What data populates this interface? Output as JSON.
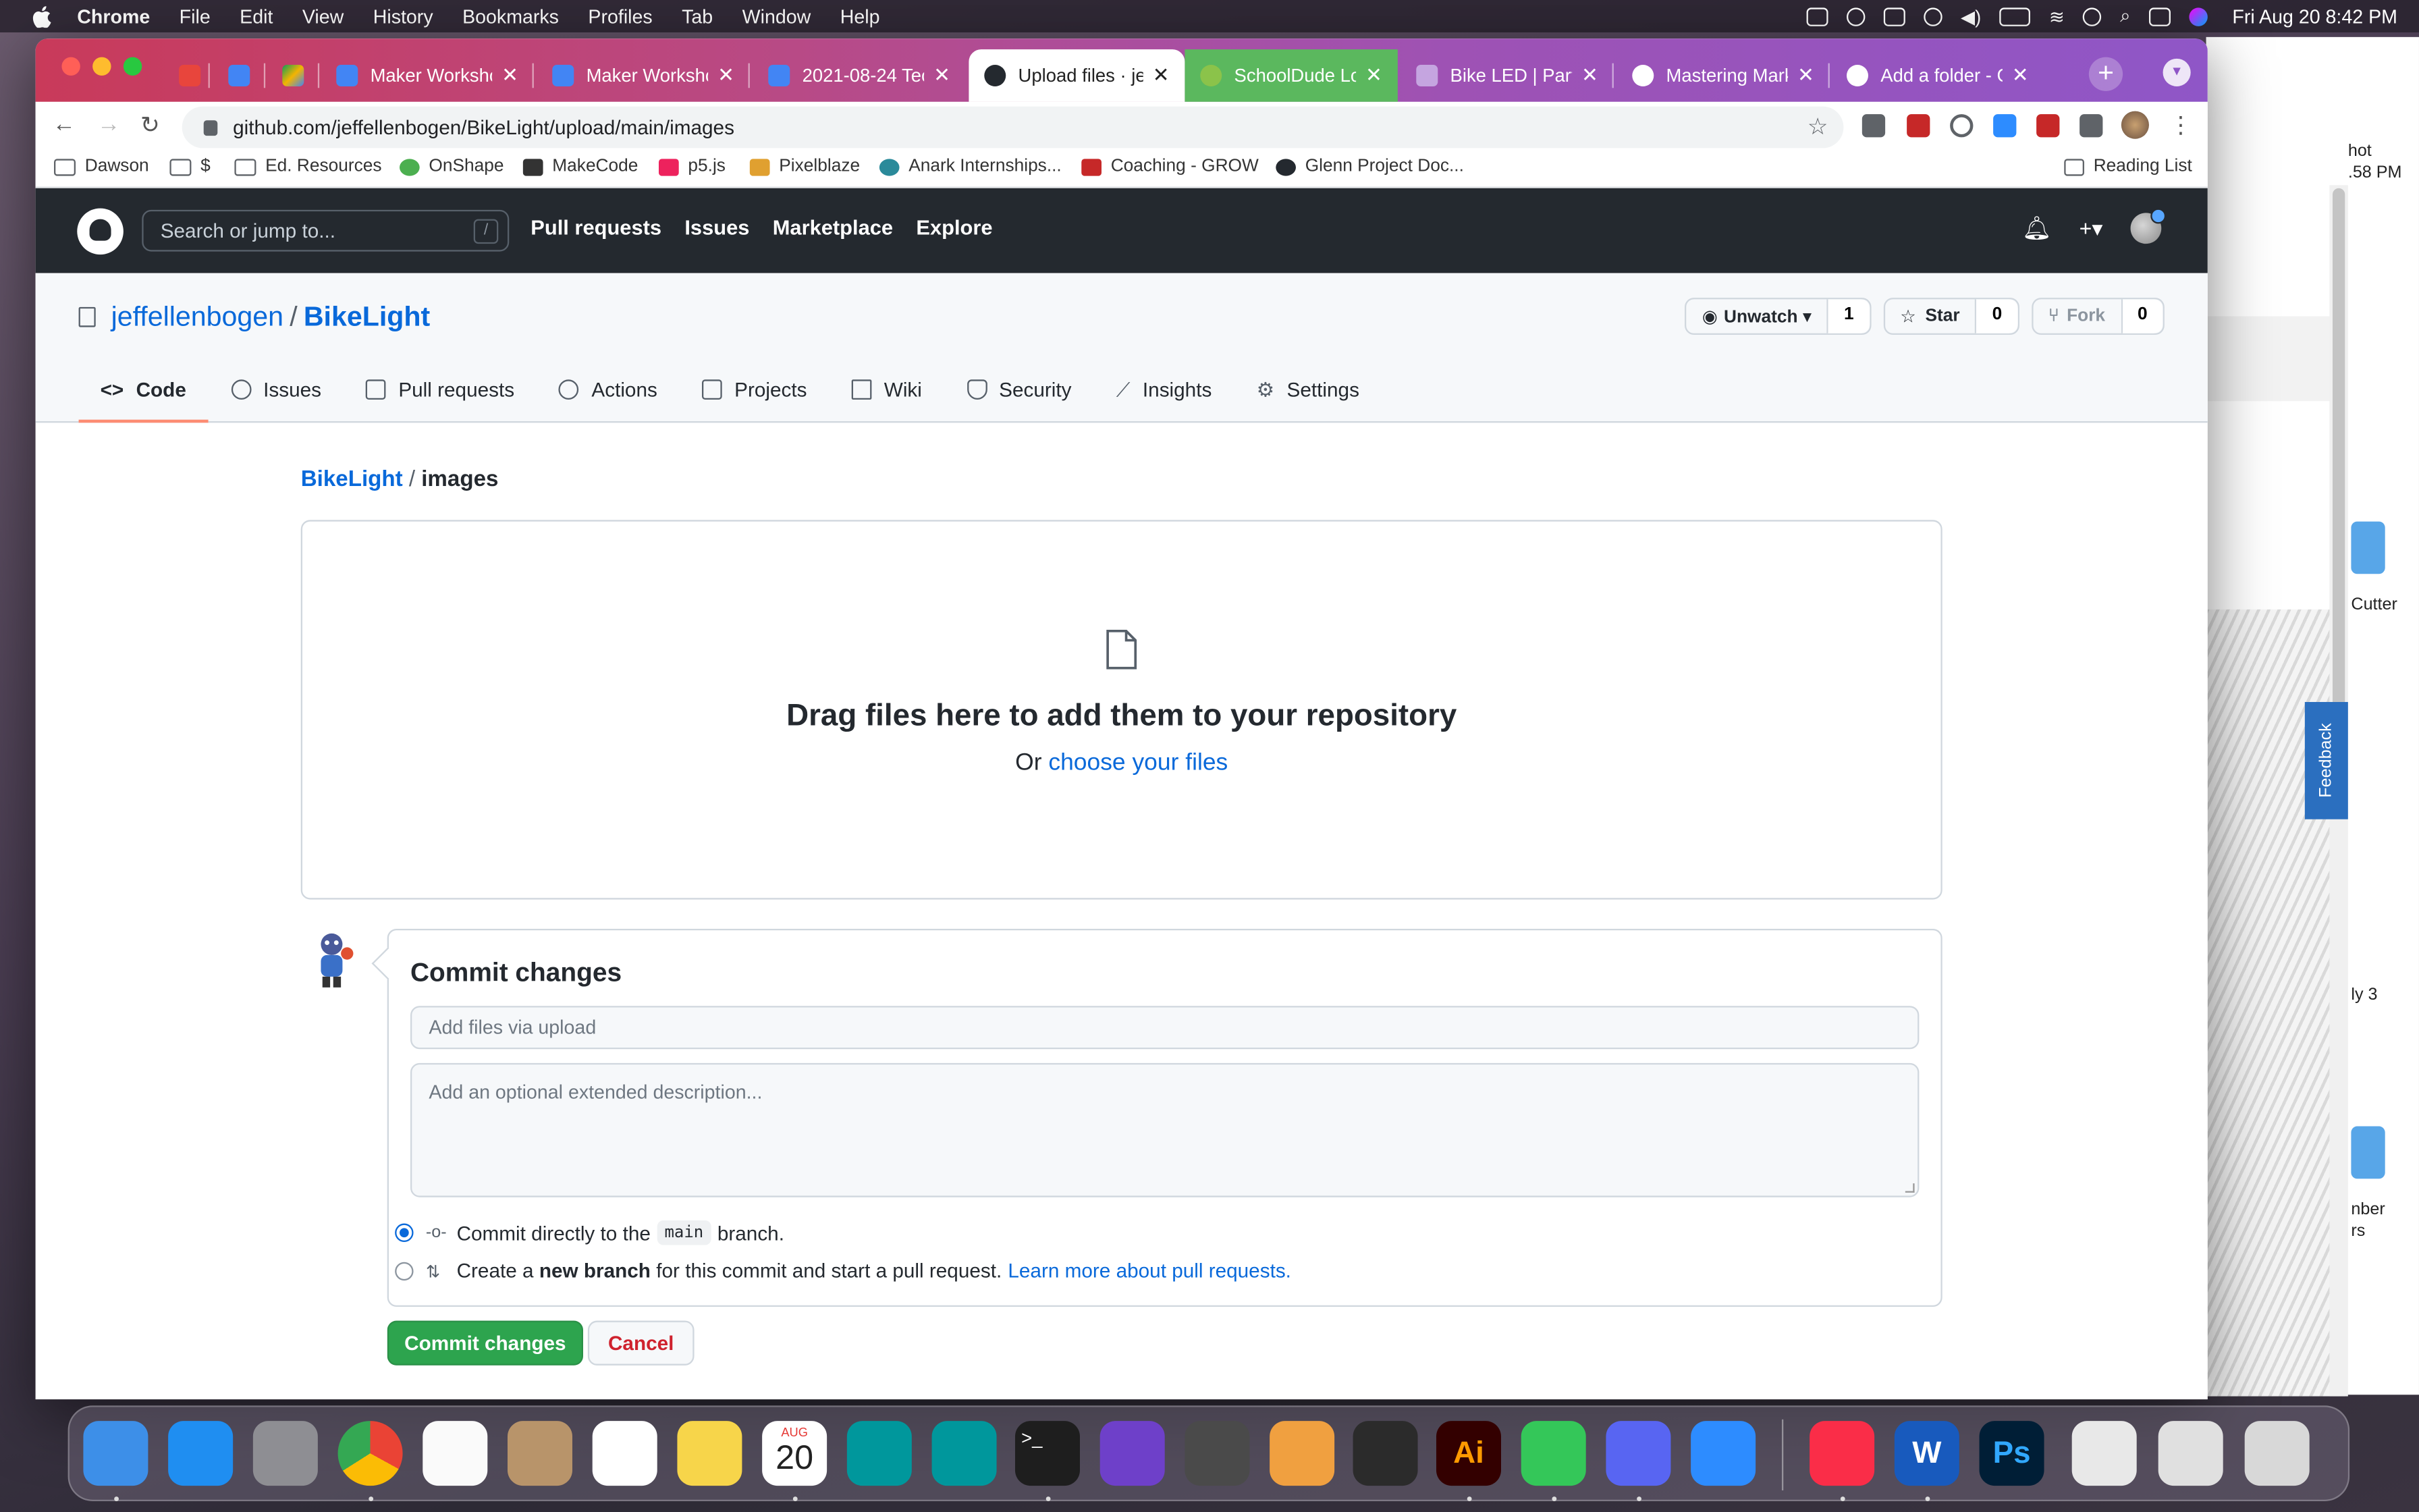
{
  "menubar": {
    "app": "Chrome",
    "items": [
      "File",
      "Edit",
      "View",
      "History",
      "Bookmarks",
      "Profiles",
      "Tab",
      "Window",
      "Help"
    ],
    "clock": "Fri Aug 20  8:42 PM"
  },
  "tabs": [
    {
      "title": "",
      "color": "#e8453c"
    },
    {
      "title": "",
      "color": "#4285f4"
    },
    {
      "title": "",
      "color": "#f4b400"
    },
    {
      "title": "Maker Workshop",
      "color": "#4285f4"
    },
    {
      "title": "Maker Workshop",
      "color": "#4285f4"
    },
    {
      "title": "2021-08-24 Tec",
      "color": "#4285f4"
    },
    {
      "title": "Upload files · jeff",
      "color": "#24292f"
    },
    {
      "title": "SchoolDude Log",
      "color": "#8bc34a"
    },
    {
      "title": "Bike LED | Part S",
      "color": "#c5a5e0"
    },
    {
      "title": "Mastering Markd",
      "color": "#ffffff"
    },
    {
      "title": "Add a folder - Gi",
      "color": "#ffffff"
    }
  ],
  "address": {
    "url": "github.com/jeffellenbogen/BikeLight/upload/main/images"
  },
  "bookmarks": [
    {
      "label": "Dawson",
      "type": "folder"
    },
    {
      "label": "$",
      "type": "folder"
    },
    {
      "label": "Ed. Resources",
      "type": "folder"
    },
    {
      "label": "OnShape",
      "color": "#4caf50"
    },
    {
      "label": "MakeCode",
      "color": "#333333"
    },
    {
      "label": "p5.js",
      "color": "#ed225d"
    },
    {
      "label": "Pixelblaze",
      "color": "#e0a030"
    },
    {
      "label": "Anark Internships...",
      "color": "#2a8a9a"
    },
    {
      "label": "Coaching - GROW",
      "color": "#c62828"
    },
    {
      "label": "Glenn Project Doc...",
      "color": "#24292f"
    }
  ],
  "reading_list": "Reading List",
  "github": {
    "search_placeholder": "Search or jump to...",
    "slash_key": "/",
    "nav": [
      "Pull requests",
      "Issues",
      "Marketplace",
      "Explore"
    ],
    "plus": "+▾",
    "owner": "jeffellenbogen",
    "repo": "BikeLight",
    "unwatch": {
      "label": "Unwatch ▾",
      "count": "1"
    },
    "star": {
      "label": "Star",
      "count": "0"
    },
    "fork": {
      "label": "Fork",
      "count": "0"
    },
    "repo_tabs": [
      "Code",
      "Issues",
      "Pull requests",
      "Actions",
      "Projects",
      "Wiki",
      "Security",
      "Insights",
      "Settings"
    ],
    "breadcrumb": {
      "repo": "BikeLight",
      "sep": "/",
      "dir": "images"
    },
    "dropzone": {
      "title": "Drag files here to add them to your repository",
      "or": "Or",
      "choose": "choose your files"
    },
    "commit": {
      "title": "Commit changes",
      "summary_placeholder": "Add files via upload",
      "description_placeholder": "Add an optional extended description...",
      "direct_pre": "Commit directly to the",
      "branch": "main",
      "direct_post": "branch.",
      "new_pre": "Create a",
      "new_bold": "new branch",
      "new_post": "for this commit and start a pull request.",
      "learn_more": "Learn more about pull requests.",
      "submit": "Commit changes",
      "cancel": "Cancel"
    }
  },
  "side": {
    "snip1": "hot",
    "snip2": ".58 PM",
    "cutter": "Cutter",
    "ly3": "ly 3",
    "nber": "nber",
    "rs": "rs",
    "feedback": "Feedback"
  },
  "dock": [
    {
      "name": "finder",
      "color": "#3d8fe8"
    },
    {
      "name": "app-store",
      "color": "#1f8ef1"
    },
    {
      "name": "system-preferences",
      "color": "#8e8e93"
    },
    {
      "name": "chrome",
      "color": "#ffffff"
    },
    {
      "name": "photos",
      "color": "#fafafa"
    },
    {
      "name": "contacts",
      "color": "#b8946a"
    },
    {
      "name": "reminders",
      "color": "#ffffff"
    },
    {
      "name": "notes",
      "color": "#f7d54a"
    },
    {
      "name": "calendar",
      "color": "#ffffff"
    },
    {
      "name": "arduino",
      "color": "#00979c"
    },
    {
      "name": "arduino-2",
      "color": "#00979c"
    },
    {
      "name": "terminal",
      "color": "#1e1e1e"
    },
    {
      "name": "github-desktop",
      "color": "#6e40c9"
    },
    {
      "name": "sublime",
      "color": "#4a4a4a"
    },
    {
      "name": "fusion-360",
      "color": "#f0a040"
    },
    {
      "name": "inkscape",
      "color": "#2b2b2b"
    },
    {
      "name": "illustrator",
      "color": "#330000"
    },
    {
      "name": "messages",
      "color": "#34c759"
    },
    {
      "name": "discord",
      "color": "#5865f2"
    },
    {
      "name": "zoom",
      "color": "#2d8cff"
    },
    {
      "name": "music",
      "color": "#fa2d48"
    },
    {
      "name": "word",
      "color": "#185abd"
    },
    {
      "name": "photoshop",
      "color": "#001e36"
    },
    {
      "name": "zip-file",
      "color": "#e8e8e8"
    },
    {
      "name": "ai-file",
      "color": "#e0e0e0"
    },
    {
      "name": "trash",
      "color": "#d8d8d8"
    }
  ],
  "dock_calendar": {
    "month": "AUG",
    "day": "20"
  },
  "dock_labels": {
    "illustrator": "Ai",
    "photoshop": "Ps",
    "word": "W"
  }
}
